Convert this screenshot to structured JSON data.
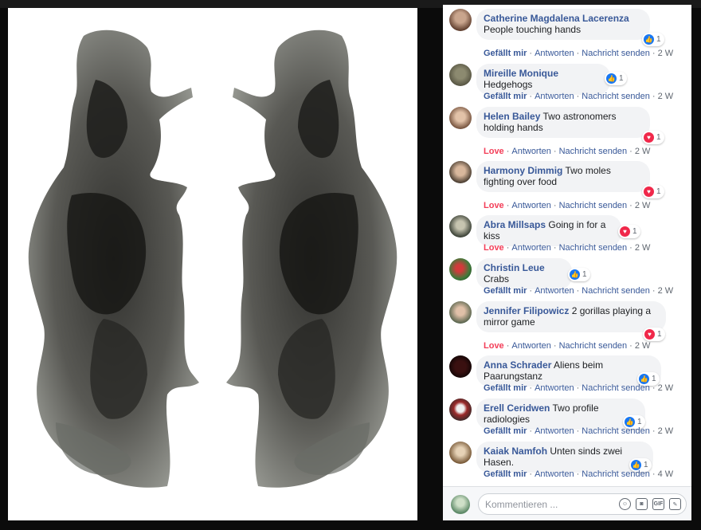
{
  "comments": [
    {
      "author": "Catherine Magdalena Lacerenza",
      "text": "People touching hands",
      "reaction": "like",
      "reaction_count": "1",
      "action": "Gefällt mir",
      "reply": "Antworten",
      "message": "Nachricht senden",
      "time": "2 W"
    },
    {
      "author": "Mireille Monique",
      "text": "Hedgehogs",
      "reaction": "like",
      "reaction_count": "1",
      "action": "Gefällt mir",
      "reply": "Antworten",
      "message": "Nachricht senden",
      "time": "2 W"
    },
    {
      "author": "Helen Bailey",
      "text": "Two astronomers holding hands",
      "reaction": "love",
      "reaction_count": "1",
      "action": "Love",
      "reply": "Antworten",
      "message": "Nachricht senden",
      "time": "2 W"
    },
    {
      "author": "Harmony Dimmig",
      "text": "Two moles fighting over food",
      "reaction": "love",
      "reaction_count": "1",
      "action": "Love",
      "reply": "Antworten",
      "message": "Nachricht senden",
      "time": "2 W"
    },
    {
      "author": "Abra Millsaps",
      "text": "Going in for a kiss",
      "reaction": "love",
      "reaction_count": "1",
      "action": "Love",
      "reply": "Antworten",
      "message": "Nachricht senden",
      "time": "2 W"
    },
    {
      "author": "Christin Leue",
      "text": "Crabs",
      "reaction": "like",
      "reaction_count": "1",
      "action": "Gefällt mir",
      "reply": "Antworten",
      "message": "Nachricht senden",
      "time": "2 W"
    },
    {
      "author": "Jennifer Filipowicz",
      "text": "2 gorillas playing a mirror game",
      "reaction": "love",
      "reaction_count": "1",
      "action": "Love",
      "reply": "Antworten",
      "message": "Nachricht senden",
      "time": "2 W"
    },
    {
      "author": "Anna Schrader",
      "text": "Aliens beim Paarungstanz",
      "reaction": "like",
      "reaction_count": "1",
      "action": "Gefällt mir",
      "reply": "Antworten",
      "message": "Nachricht senden",
      "time": "2 W"
    },
    {
      "author": "Erell Ceridwen",
      "text": "Two profile radiologies",
      "reaction": "like",
      "reaction_count": "1",
      "action": "Gefällt mir",
      "reply": "Antworten",
      "message": "Nachricht senden",
      "time": "2 W"
    },
    {
      "author": "Kaiak Namfoh",
      "text": "Unten sinds zwei Hasen.",
      "reaction": "like",
      "reaction_count": "1",
      "action": "Gefällt mir",
      "reply": "Antworten",
      "message": "Nachricht senden",
      "time": "4 W"
    }
  ],
  "composer": {
    "placeholder": "Kommentieren ...",
    "tools": [
      "emoji-icon",
      "camera-icon",
      "gif-icon",
      "sticker-icon"
    ],
    "gif_label": "GIF"
  },
  "colors": {
    "link": "#385898",
    "love": "#f33e58",
    "like_badge": "#1877f2",
    "bubble": "#f2f3f5"
  }
}
